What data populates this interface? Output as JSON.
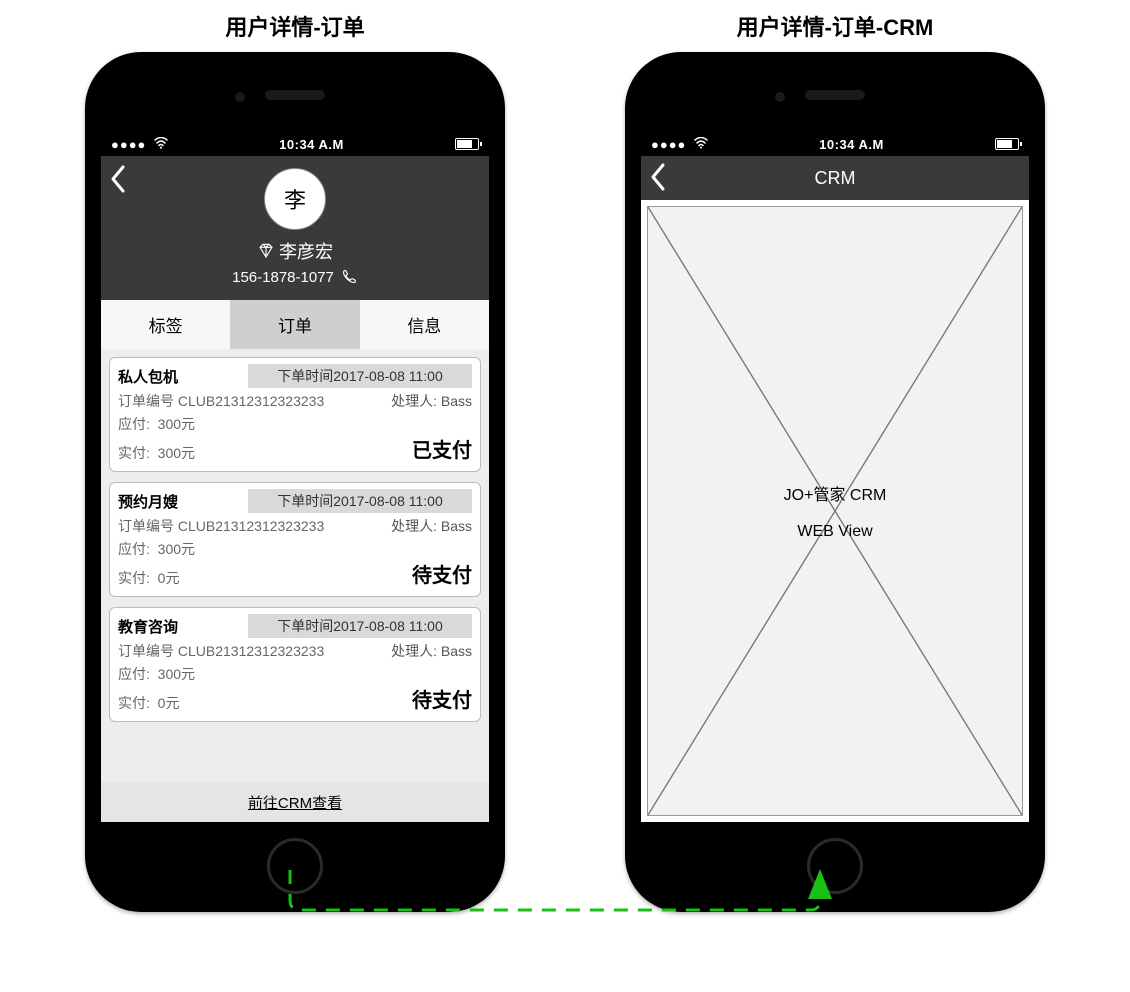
{
  "titles": {
    "left": "用户详情-订单",
    "right": "用户详情-订单-CRM"
  },
  "statusbar": {
    "signal": "●●●●",
    "time": "10:34 A.M"
  },
  "profile": {
    "avatar_initial": "李",
    "name": "李彦宏",
    "phone": "156-1878-1077"
  },
  "tabs": {
    "tag": "标签",
    "order": "订单",
    "info": "信息"
  },
  "labels": {
    "order_no_prefix": "订单编号",
    "due_prefix": "应付:",
    "paid_prefix": "实付:",
    "handler_prefix": "处理人:",
    "order_time_prefix": "下单时间"
  },
  "orders": [
    {
      "type": "私人包机",
      "time": "2017-08-08 11:00",
      "order_no": "CLUB21312312323233",
      "handler": "Bass",
      "due": "300元",
      "paid": "300元",
      "status": "已支付"
    },
    {
      "type": "预约月嫂",
      "time": "2017-08-08 11:00",
      "order_no": "CLUB21312312323233",
      "handler": "Bass",
      "due": "300元",
      "paid": "0元",
      "status": "待支付"
    },
    {
      "type": "教育咨询",
      "time": "2017-08-08 11:00",
      "order_no": "CLUB21312312323233",
      "handler": "Bass",
      "due": "300元",
      "paid": "0元",
      "status": "待支付"
    }
  ],
  "bottom_link": "前往CRM查看",
  "crm": {
    "header_title": "CRM",
    "placeholder_line1": "JO+管家 CRM",
    "placeholder_line2": "WEB View"
  }
}
